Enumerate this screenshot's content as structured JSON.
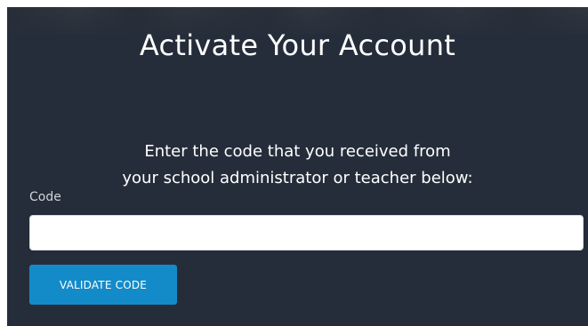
{
  "page": {
    "title": "Activate Your Account",
    "instruction_line1": "Enter the code that you received from",
    "instruction_line2": "your school administrator or teacher below:"
  },
  "form": {
    "code_label": "Code",
    "code_value": "",
    "code_placeholder": "",
    "submit_label": "VALIDATE CODE"
  },
  "colors": {
    "panel_background": "#252d3a",
    "button_accent": "#148bc9",
    "text_primary": "#ffffff"
  }
}
